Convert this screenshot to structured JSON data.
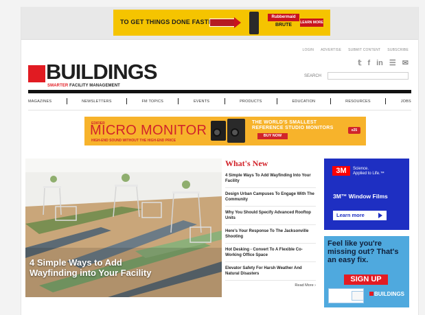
{
  "top_ad": {
    "text": "TO GET THINGS DONE FASTER",
    "brand_top": "Rubbermaid",
    "brand_main": "BRUTE",
    "cta": "LEARN MORE",
    "color": "#f5c400"
  },
  "utility_nav": [
    "LOGIN",
    "ADVERTISE",
    "SUBMIT CONTENT",
    "SUBSCRIBE"
  ],
  "social_icons": [
    {
      "name": "twitter-icon",
      "glyph": "𝕥"
    },
    {
      "name": "facebook-icon",
      "glyph": "f"
    },
    {
      "name": "linkedin-icon",
      "glyph": "in"
    },
    {
      "name": "rss-icon",
      "glyph": "☰"
    },
    {
      "name": "email-icon",
      "glyph": "✉"
    }
  ],
  "logo": {
    "text": "BUILDINGS",
    "tagline_highlight": "SMARTER",
    "tagline_rest": "FACILITY MANAGEMENT",
    "brand_color": "#e11b22"
  },
  "search": {
    "label": "SEARCH",
    "placeholder": ""
  },
  "main_nav": [
    "MAGAZINES",
    "NEWSLETTERS",
    "FM TOPICS",
    "EVENTS",
    "PRODUCTS",
    "EDUCATION",
    "RESOURCES",
    "JOBS"
  ],
  "micro_monitor_ad": {
    "kicker": "EDIFIER",
    "title": "MICRO MONITOR",
    "subtitle": "HIGH-END SOUND WITHOUT THE HIGH-END PRICE",
    "tagline": "THE WORLD'S SMALLEST REFERENCE STUDIO MONITORS",
    "cta": "BUY NOW",
    "logo": "e25"
  },
  "hero": {
    "caption": "4 Simple Ways to Add Wayfinding into Your Facility"
  },
  "whats_new": {
    "title": "What's New",
    "items": [
      "4 Simple Ways To Add Wayfinding Into Your Facility",
      "Design Urban Campuses To Engage With The Community",
      "Why You Should Specify Advanced Rooftop Units",
      "Here's Your Response To The Jacksonville Shooting",
      "Hot Desking - Convert To A Flexible Co-Working Office Space",
      "Elevator Safety For Harsh Weather And Natural Disasters"
    ],
    "read_more": "Read More ›"
  },
  "ad_3m": {
    "logo": "3M",
    "slogan_line1": "Science.",
    "slogan_line2": "Applied to Life.™",
    "product": "3M™ Window Films",
    "cta": "Learn more",
    "color": "#1e2fc2"
  },
  "ad_signup": {
    "text": "Feel like you're missing out? That's an easy fix.",
    "cta": "SIGN UP",
    "logo": "BUILDINGS",
    "color": "#4fa9de"
  }
}
